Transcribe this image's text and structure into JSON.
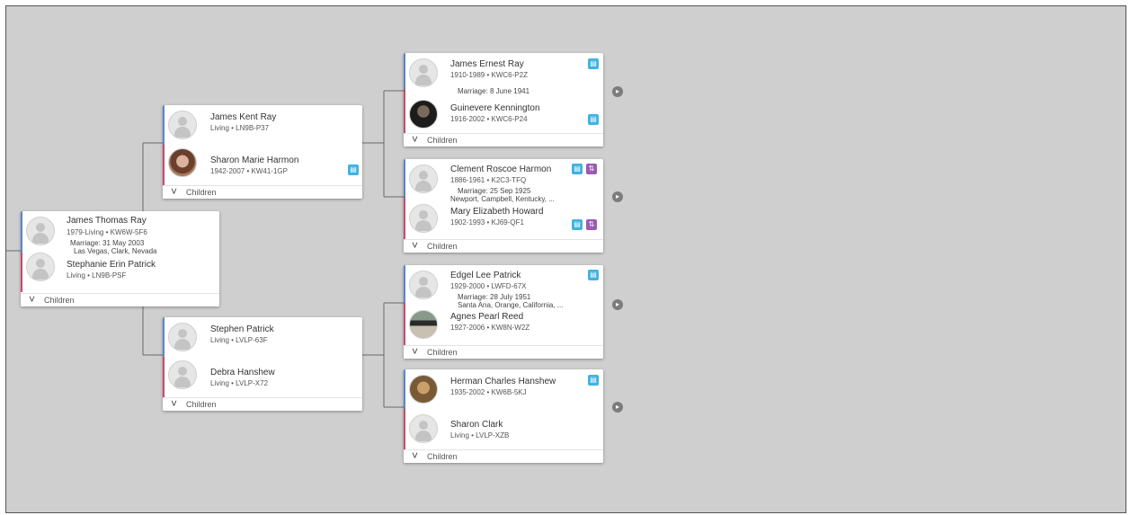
{
  "children_label": "Children",
  "icons": {
    "chevron": "chevron-down-icon",
    "record_hint": "record-hint-icon",
    "tree_hint": "tree-hint-icon",
    "expand": "expand-ancestors-icon"
  },
  "colors": {
    "background": "#cfcfcf",
    "male_stripe": "#5a86c6",
    "female_stripe": "#c94a6b",
    "hint_blue": "#3fb3e0",
    "hint_purple": "#9a5bb0"
  },
  "root": {
    "husband": {
      "name": "James Thomas Ray",
      "meta": "1979-Living • KW6W-5F6"
    },
    "marriage_line1": "Marriage: 31 May 2003",
    "marriage_line2": "Las Vegas, Clark, Nevada",
    "wife": {
      "name": "Stephanie Erin Patrick",
      "meta": "Living • LN9B-PSF"
    }
  },
  "parents_father": {
    "husband": {
      "name": "James Kent Ray",
      "meta": "Living • LN9B-P37"
    },
    "wife": {
      "name": "Sharon Marie Harmon",
      "meta": "1942-2007 • KW41-1GP"
    }
  },
  "parents_mother": {
    "husband": {
      "name": "Stephen Patrick",
      "meta": "Living • LVLP-63F"
    },
    "wife": {
      "name": "Debra Hanshew",
      "meta": "Living • LVLP-X72"
    }
  },
  "gp_ray": {
    "husband": {
      "name": "James Ernest Ray",
      "meta": "1910-1989 • KWC6-P2Z"
    },
    "marriage_line1": "Marriage: 8 June 1941",
    "wife": {
      "name": "Guinevere Kennington",
      "meta": "1916-2002 • KWC6-P24"
    }
  },
  "gp_harmon": {
    "husband": {
      "name": "Clement Roscoe Harmon",
      "meta": "1886-1961 • K2C3-TFQ"
    },
    "marriage_line1": "Marriage: 25 Sep 1925",
    "marriage_line2": "Newport, Campbell, Kentucky, ...",
    "wife": {
      "name": "Mary Elizabeth Howard",
      "meta": "1902-1993 • KJ69-QF1"
    }
  },
  "gp_patrick": {
    "husband": {
      "name": "Edgel Lee Patrick",
      "meta": "1929-2000 • LWFD-67X"
    },
    "marriage_line1": "Marriage: 28 July 1951",
    "marriage_line2": "Santa Ana, Orange, California, ...",
    "wife": {
      "name": "Agnes Pearl Reed",
      "meta": "1927-2006 • KW8N-W2Z"
    }
  },
  "gp_hanshew": {
    "husband": {
      "name": "Herman Charles Hanshew",
      "meta": "1935-2002 • KW6B-5KJ"
    },
    "wife": {
      "name": "Sharon Clark",
      "meta": "Living • LVLP-XZB"
    }
  }
}
